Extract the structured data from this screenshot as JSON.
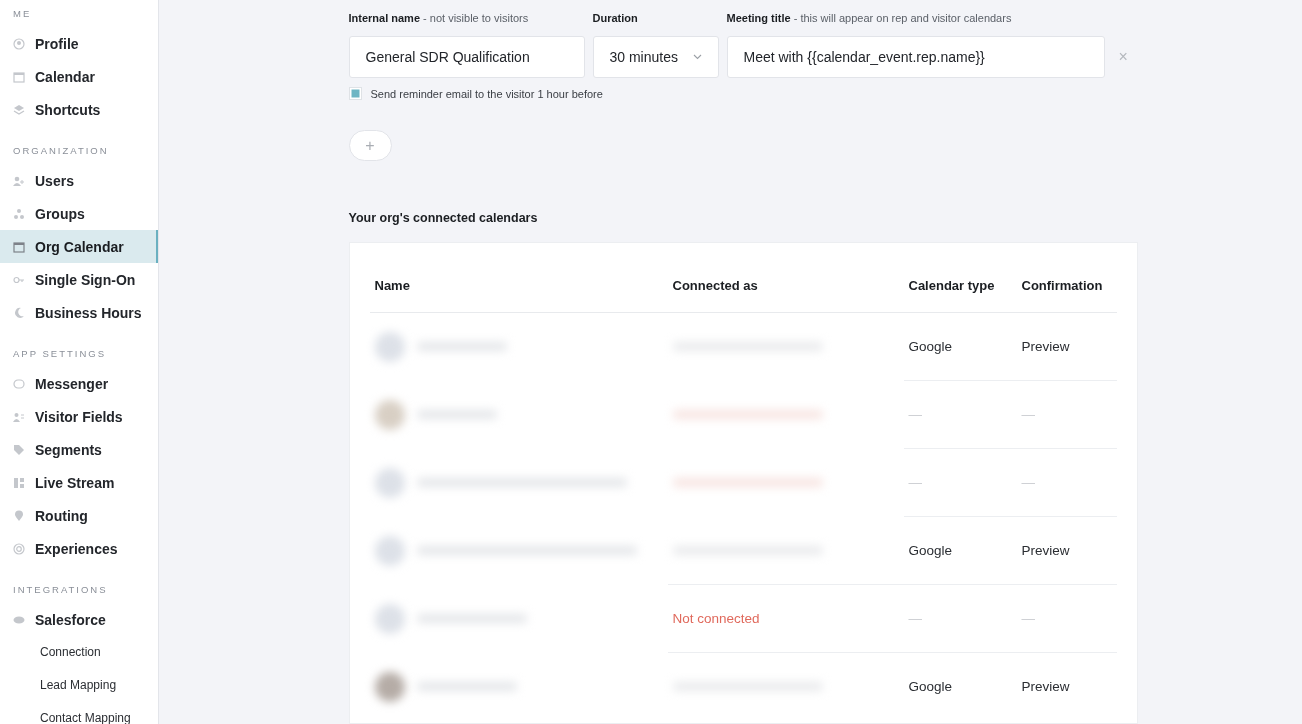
{
  "sidebar": {
    "sections": [
      {
        "heading": "ME",
        "items": [
          {
            "label": "Profile",
            "selected": false
          },
          {
            "label": "Calendar",
            "selected": false
          },
          {
            "label": "Shortcuts",
            "selected": false
          }
        ]
      },
      {
        "heading": "ORGANIZATION",
        "items": [
          {
            "label": "Users",
            "selected": false
          },
          {
            "label": "Groups",
            "selected": false
          },
          {
            "label": "Org Calendar",
            "selected": true
          },
          {
            "label": "Single Sign-On",
            "selected": false
          },
          {
            "label": "Business Hours",
            "selected": false
          }
        ]
      },
      {
        "heading": "APP SETTINGS",
        "items": [
          {
            "label": "Messenger",
            "selected": false
          },
          {
            "label": "Visitor Fields",
            "selected": false
          },
          {
            "label": "Segments",
            "selected": false
          },
          {
            "label": "Live Stream",
            "selected": false
          },
          {
            "label": "Routing",
            "selected": false
          },
          {
            "label": "Experiences",
            "selected": false
          }
        ]
      },
      {
        "heading": "INTEGRATIONS",
        "items": [
          {
            "label": "Salesforce",
            "selected": false,
            "children": [
              {
                "label": "Connection"
              },
              {
                "label": "Lead Mapping"
              },
              {
                "label": "Contact Mapping"
              }
            ]
          }
        ]
      }
    ]
  },
  "meeting_form": {
    "internal_name": {
      "label": "Internal name",
      "hint": " - not visible to visitors",
      "value": "General SDR Qualification"
    },
    "duration": {
      "label": "Duration",
      "value": "30 minutes"
    },
    "meeting_title": {
      "label": "Meeting title",
      "hint": " - this will appear on rep and visitor calendars",
      "value": "Meet with {{calendar_event.rep.name}}"
    },
    "remove_symbol": "×",
    "reminder": {
      "label": "Send reminder email to the visitor 1 hour before",
      "checked": true
    },
    "add_symbol": "+"
  },
  "calendars": {
    "title": "Your org's connected calendars",
    "columns": [
      "Name",
      "Connected as",
      "Calendar type",
      "Confirmation"
    ],
    "rows": [
      {
        "connected": true,
        "calendar_type": "Google",
        "confirmation": "Preview"
      },
      {
        "connected": false,
        "calendar_type": "—",
        "confirmation": "—"
      },
      {
        "connected": false,
        "calendar_type": "—",
        "confirmation": "—"
      },
      {
        "connected": true,
        "calendar_type": "Google",
        "confirmation": "Preview"
      },
      {
        "connected": false,
        "connected_as": "Not connected",
        "calendar_type": "—",
        "confirmation": "—"
      },
      {
        "connected": true,
        "calendar_type": "Google",
        "confirmation": "Preview"
      }
    ]
  }
}
